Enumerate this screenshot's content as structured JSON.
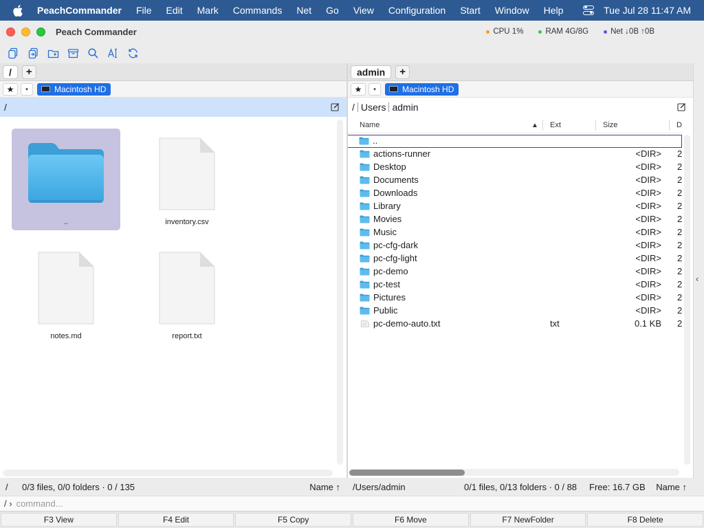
{
  "menubar": {
    "app_name": "PeachCommander",
    "items": [
      "File",
      "Edit",
      "Mark",
      "Commands",
      "Net",
      "Go",
      "View",
      "Configuration",
      "Start",
      "Window",
      "Help"
    ],
    "clock": "Tue Jul 28  11:47 AM"
  },
  "window": {
    "title": "Peach Commander",
    "stats": {
      "cpu": "CPU 1%",
      "ram": "RAM 4G/8G",
      "net": "Net ↓0B ↑0B",
      "cpu_color": "#f0a020",
      "ram_color": "#34c759",
      "net_color": "#5b5bd6"
    }
  },
  "toolbar": {
    "icons": [
      "copy-icon",
      "move-icon",
      "new-folder-icon",
      "archive-icon",
      "search-icon",
      "rename-icon",
      "refresh-icon"
    ]
  },
  "left_pane": {
    "tab_label": "/",
    "add_tab_label": "+",
    "star_label": "★",
    "dropdown_label": "▾",
    "drive_label": "Macintosh HD",
    "path_root": "/",
    "items": [
      {
        "name": "..",
        "type": "folder",
        "selected": true
      },
      {
        "name": "inventory.csv",
        "type": "file",
        "selected": false
      },
      {
        "name": "notes.md",
        "type": "file",
        "selected": false
      },
      {
        "name": "report.txt",
        "type": "file",
        "selected": false
      }
    ],
    "status": {
      "path": "/",
      "summary": "0/3 files, 0/0 folders · 0 / 135",
      "sort": "Name ↑"
    }
  },
  "right_pane": {
    "tab_label": "admin",
    "add_tab_label": "+",
    "star_label": "★",
    "dropdown_label": "▾",
    "drive_label": "Macintosh HD",
    "path_segments": [
      "/",
      "Users",
      "admin"
    ],
    "columns": {
      "name": "Name",
      "ext": "Ext",
      "size": "Size",
      "date": "D",
      "sort_indicator": "▲"
    },
    "rows": [
      {
        "name": "..",
        "ext": "",
        "size": "",
        "date": "",
        "type": "folder",
        "focused": true
      },
      {
        "name": "actions-runner",
        "ext": "",
        "size": "<DIR>",
        "date": "2",
        "type": "folder"
      },
      {
        "name": "Desktop",
        "ext": "",
        "size": "<DIR>",
        "date": "2",
        "type": "folder"
      },
      {
        "name": "Documents",
        "ext": "",
        "size": "<DIR>",
        "date": "2",
        "type": "folder"
      },
      {
        "name": "Downloads",
        "ext": "",
        "size": "<DIR>",
        "date": "2",
        "type": "folder"
      },
      {
        "name": "Library",
        "ext": "",
        "size": "<DIR>",
        "date": "2",
        "type": "folder"
      },
      {
        "name": "Movies",
        "ext": "",
        "size": "<DIR>",
        "date": "2",
        "type": "folder"
      },
      {
        "name": "Music",
        "ext": "",
        "size": "<DIR>",
        "date": "2",
        "type": "folder"
      },
      {
        "name": "pc-cfg-dark",
        "ext": "",
        "size": "<DIR>",
        "date": "2",
        "type": "folder"
      },
      {
        "name": "pc-cfg-light",
        "ext": "",
        "size": "<DIR>",
        "date": "2",
        "type": "folder"
      },
      {
        "name": "pc-demo",
        "ext": "",
        "size": "<DIR>",
        "date": "2",
        "type": "folder"
      },
      {
        "name": "pc-test",
        "ext": "",
        "size": "<DIR>",
        "date": "2",
        "type": "folder"
      },
      {
        "name": "Pictures",
        "ext": "",
        "size": "<DIR>",
        "date": "2",
        "type": "folder"
      },
      {
        "name": "Public",
        "ext": "",
        "size": "<DIR>",
        "date": "2",
        "type": "folder"
      },
      {
        "name": "pc-demo-auto.txt",
        "ext": "txt",
        "size": "0.1 KB",
        "date": "2",
        "type": "file"
      }
    ],
    "status": {
      "path": "/Users/admin",
      "summary": "0/1 files, 0/13 folders · 0 / 88",
      "free": "Free: 16.7 GB",
      "sort": "Name ↑"
    }
  },
  "command_line": {
    "prompt": "/ ›",
    "placeholder": "command..."
  },
  "function_keys": [
    "F3 View",
    "F4 Edit",
    "F5 Copy",
    "F6 Move",
    "F7 NewFolder",
    "F8 Delete"
  ],
  "colors": {
    "menubar": "#2d5a93",
    "drive_badge": "#1f6fe5",
    "active_path": "#cfe2fb",
    "selection": "#c5c3e0",
    "folder": "#4fb3ea"
  }
}
